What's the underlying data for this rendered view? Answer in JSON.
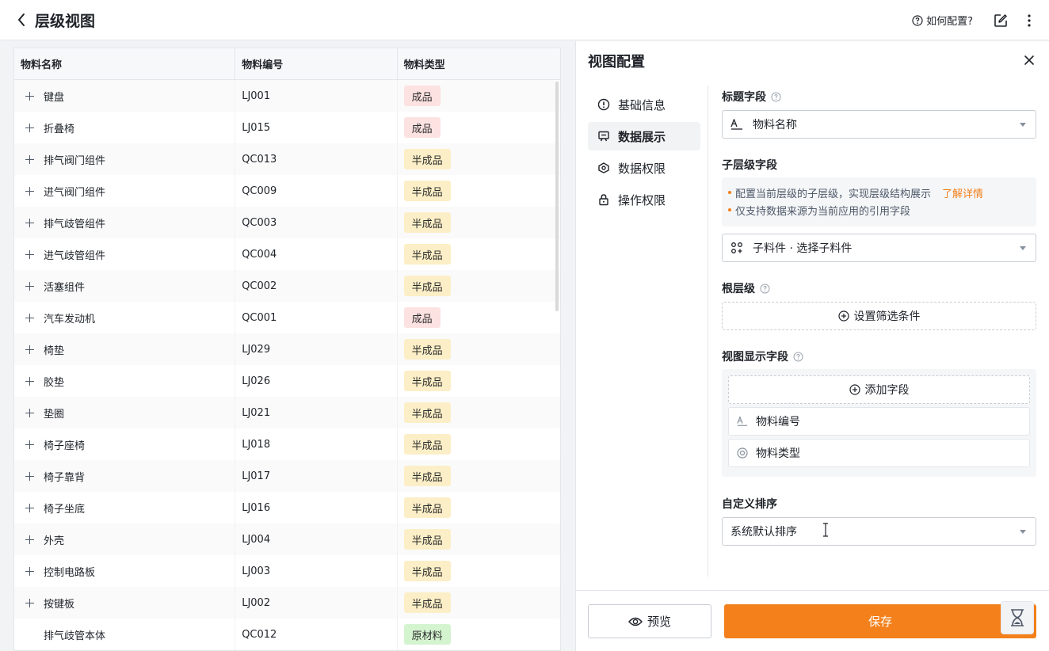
{
  "header": {
    "title": "层级视图",
    "help_label": "如何配置?"
  },
  "table": {
    "columns": [
      "物料名称",
      "物料编号",
      "物料类型"
    ],
    "rows": [
      {
        "name": "键盘",
        "code": "LJ001",
        "type": "成品",
        "type_kind": "finished",
        "expandable": true
      },
      {
        "name": "折叠椅",
        "code": "LJ015",
        "type": "成品",
        "type_kind": "finished",
        "expandable": true
      },
      {
        "name": "排气阀门组件",
        "code": "QC013",
        "type": "半成品",
        "type_kind": "semi",
        "expandable": true
      },
      {
        "name": "进气阀门组件",
        "code": "QC009",
        "type": "半成品",
        "type_kind": "semi",
        "expandable": true
      },
      {
        "name": "排气歧管组件",
        "code": "QC003",
        "type": "半成品",
        "type_kind": "semi",
        "expandable": true
      },
      {
        "name": "进气歧管组件",
        "code": "QC004",
        "type": "半成品",
        "type_kind": "semi",
        "expandable": true
      },
      {
        "name": "活塞组件",
        "code": "QC002",
        "type": "半成品",
        "type_kind": "semi",
        "expandable": true
      },
      {
        "name": "汽车发动机",
        "code": "QC001",
        "type": "成品",
        "type_kind": "finished",
        "expandable": true
      },
      {
        "name": "椅垫",
        "code": "LJ029",
        "type": "半成品",
        "type_kind": "semi",
        "expandable": true
      },
      {
        "name": "胶垫",
        "code": "LJ026",
        "type": "半成品",
        "type_kind": "semi",
        "expandable": true
      },
      {
        "name": "垫圈",
        "code": "LJ021",
        "type": "半成品",
        "type_kind": "semi",
        "expandable": true
      },
      {
        "name": "椅子座椅",
        "code": "LJ018",
        "type": "半成品",
        "type_kind": "semi",
        "expandable": true
      },
      {
        "name": "椅子靠背",
        "code": "LJ017",
        "type": "半成品",
        "type_kind": "semi",
        "expandable": true
      },
      {
        "name": "椅子坐底",
        "code": "LJ016",
        "type": "半成品",
        "type_kind": "semi",
        "expandable": true
      },
      {
        "name": "外壳",
        "code": "LJ004",
        "type": "半成品",
        "type_kind": "semi",
        "expandable": true
      },
      {
        "name": "控制电路板",
        "code": "LJ003",
        "type": "半成品",
        "type_kind": "semi",
        "expandable": true
      },
      {
        "name": "按键板",
        "code": "LJ002",
        "type": "半成品",
        "type_kind": "semi",
        "expandable": true
      },
      {
        "name": "排气歧管本体",
        "code": "QC012",
        "type": "原材料",
        "type_kind": "raw",
        "expandable": false
      }
    ]
  },
  "config": {
    "title": "视图配置",
    "nav": [
      "基础信息",
      "数据展示",
      "数据权限",
      "操作权限"
    ],
    "active_nav": 1,
    "title_field": {
      "label": "标题字段",
      "value": "物料名称"
    },
    "child_field": {
      "label": "子层级字段",
      "tip1": "配置当前层级的子层级，实现层级结构展示",
      "learn_more": "了解详情",
      "tip2": "仅支持数据来源为当前应用的引用字段",
      "value": "子料件 · 选择子料件"
    },
    "root": {
      "label": "根层级",
      "button": "设置筛选条件"
    },
    "display_fields": {
      "label": "视图显示字段",
      "add_button": "添加字段",
      "items": [
        "物料编号",
        "物料类型"
      ]
    },
    "sort": {
      "label": "自定义排序",
      "value": "系统默认排序"
    },
    "preview_label": "预览",
    "save_label": "保存"
  },
  "colors": {
    "accent": "#f3801b",
    "tag_finished": "#fde2e2",
    "tag_semi": "#fcefc7",
    "tag_raw": "#d4f4d0"
  }
}
